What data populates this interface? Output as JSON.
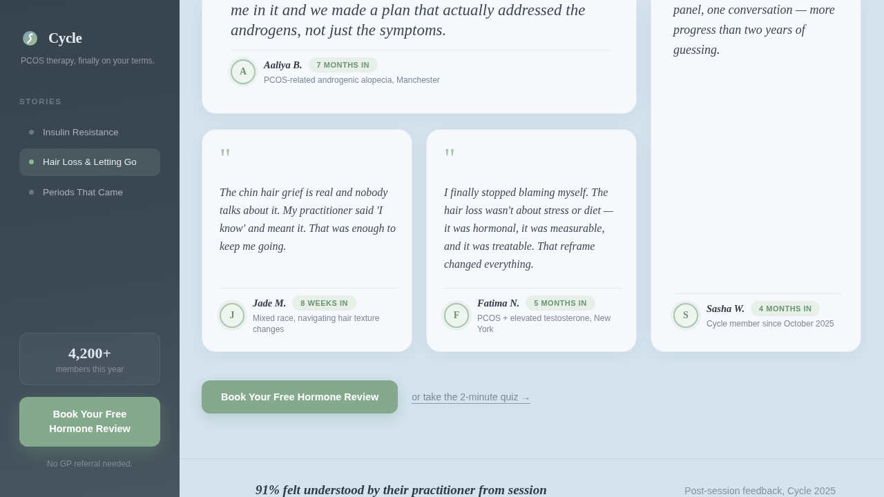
{
  "sidebar": {
    "brand": {
      "name": "Cycle",
      "tagline": "PCOS therapy, finally on your terms."
    },
    "section_label": "STORIES",
    "items": [
      {
        "label": "Insulin Resistance",
        "selected": false
      },
      {
        "label": "Hair Loss & Letting Go",
        "selected": true
      },
      {
        "label": "Periods That Came",
        "selected": false
      }
    ],
    "stat": {
      "value": "4,200+",
      "label": "members this year"
    },
    "cta": "Book Your Free Hormone Review",
    "note": "No GP referral needed."
  },
  "testimonials": [
    {
      "kind": "wide",
      "quote": "me in it and we made a plan that actually addressed the androgens, not just the symptoms.",
      "initial": "A",
      "name": "Aaliya B.",
      "badge": "7 MONTHS IN",
      "detail": "PCOS-related androgenic alopecia, Manchester"
    },
    {
      "kind": "small",
      "quote_mark": "\"",
      "quote": "The chin hair grief is real and nobody talks about it. My practitioner said 'I know' and meant it. That was enough to keep me going.",
      "initial": "J",
      "name": "Jade M.",
      "badge": "8 WEEKS IN",
      "detail": "Mixed race, navigating hair texture changes"
    },
    {
      "kind": "small",
      "quote_mark": "\"",
      "quote": "I finally stopped blaming myself. The hair loss wasn't about stress or diet — it was hormonal, it was measurable, and it was treatable. That reframe changed everything.",
      "initial": "F",
      "name": "Fatima N.",
      "badge": "5 MONTHS IN",
      "detail": "PCOS + elevated testosterone, New York"
    },
    {
      "kind": "tall",
      "quote": "panel, one conversation — more progress than two years of guessing.",
      "initial": "S",
      "name": "Sasha W.",
      "badge": "4 MONTHS IN",
      "detail": "Cycle member since October 2025"
    }
  ],
  "actions": {
    "button": "Book Your Free Hormone Review",
    "link": "or take the 2-minute quiz →"
  },
  "footer": {
    "stat": "91% felt understood by their practitioner from session",
    "source": "Post-session feedback, Cycle 2025"
  }
}
